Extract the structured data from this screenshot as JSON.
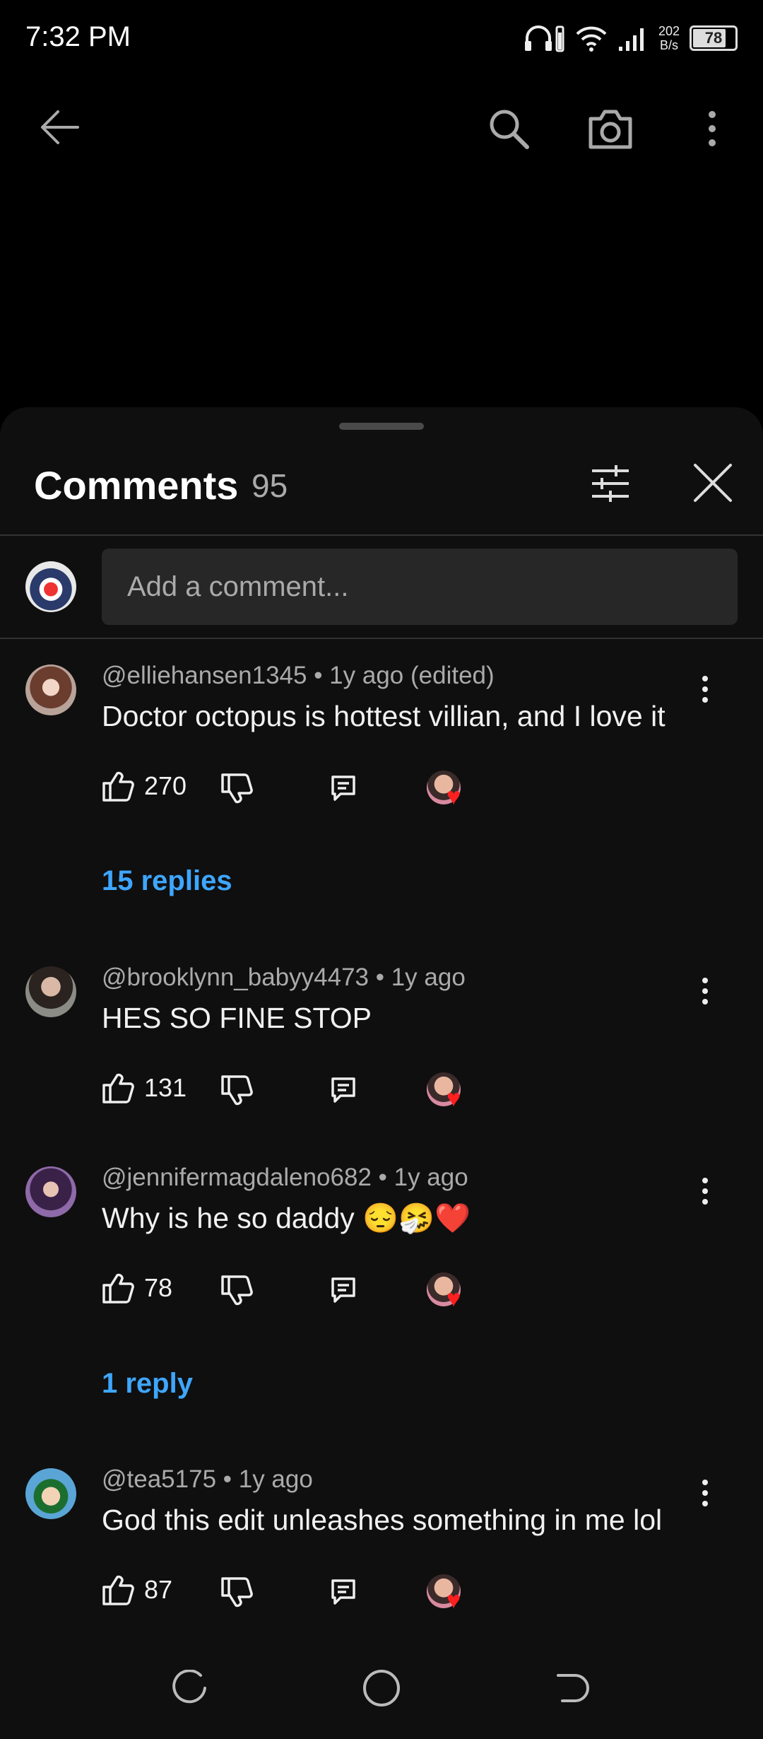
{
  "status_bar": {
    "time": "7:32 PM",
    "speed_value": "202",
    "speed_unit": "B/s",
    "battery": "78",
    "icons": [
      "headphones-battery-icon",
      "wifi-icon",
      "signal-icon",
      "battery-icon"
    ]
  },
  "top_bar": {
    "icons": [
      "back-arrow-icon",
      "search-icon",
      "camera-icon",
      "more-vert-icon"
    ]
  },
  "comments_panel": {
    "title": "Comments",
    "count": "95",
    "add_placeholder": "Add a comment...",
    "icons": [
      "sort-filter-icon",
      "close-icon"
    ]
  },
  "comments": [
    {
      "meta": "@elliehansen1345 • 1y ago (edited)",
      "text": "Doctor octopus is hottest villian, and I love it",
      "likes": "270",
      "replies": "15 replies"
    },
    {
      "meta": "@brooklynn_babyy4473 • 1y ago",
      "text": "HES SO FINE STOP",
      "likes": "131",
      "replies": ""
    },
    {
      "meta": "@jennifermagdaleno682 • 1y ago",
      "text": "Why is he so daddy 😔🤧❤️",
      "likes": "78",
      "replies": "1 reply"
    },
    {
      "meta": "@tea5175 • 1y ago",
      "text": "God this edit unleashes something in me lol",
      "likes": "87",
      "replies": ""
    }
  ],
  "colors": {
    "background": "#000000",
    "sheet": "#0f0f0f",
    "input_bg": "#272727",
    "link": "#3ea6ff",
    "heart": "#ff1f1f"
  },
  "nav_bar": {
    "icons": [
      "recents-icon",
      "home-icon",
      "back-icon"
    ]
  }
}
